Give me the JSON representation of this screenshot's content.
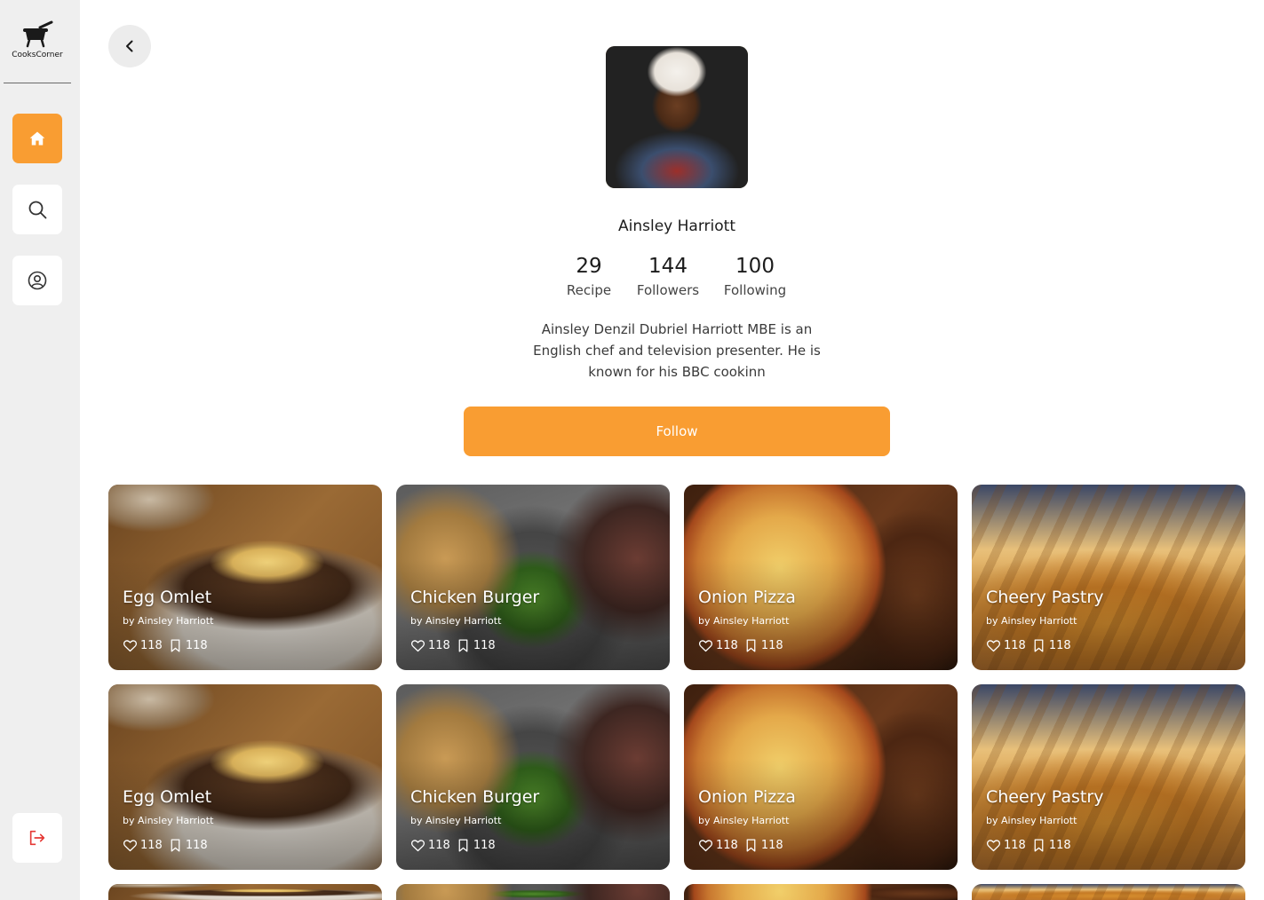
{
  "app": {
    "name": "CooksCorner"
  },
  "colors": {
    "accent": "#F99D32",
    "sidebar_bg": "#EFEFEF",
    "logout_icon": "#E53935"
  },
  "sidebar": {
    "items": [
      {
        "icon": "home-icon",
        "active": true
      },
      {
        "icon": "search-icon",
        "active": false
      },
      {
        "icon": "user-circle-icon",
        "active": false
      }
    ],
    "logout_icon": "logout-icon"
  },
  "profile": {
    "name": "Ainsley Harriott",
    "stats": [
      {
        "value": "29",
        "label": "Recipe"
      },
      {
        "value": "144",
        "label": "Followers"
      },
      {
        "value": "100",
        "label": "Following"
      }
    ],
    "bio": "Ainsley Denzil Dubriel Harriott MBE is an English chef and television presenter. He is known for his BBC cookinn",
    "follow_label": "Follow"
  },
  "recipes": [
    {
      "title": "Egg Omlet",
      "author": "by Ainsley Harriott",
      "likes": "118",
      "saves": "118"
    },
    {
      "title": "Chicken Burger",
      "author": "by Ainsley Harriott",
      "likes": "118",
      "saves": "118"
    },
    {
      "title": "Onion Pizza",
      "author": "by Ainsley Harriott",
      "likes": "118",
      "saves": "118"
    },
    {
      "title": "Cheery Pastry",
      "author": "by Ainsley Harriott",
      "likes": "118",
      "saves": "118"
    },
    {
      "title": "Egg Omlet",
      "author": "by Ainsley Harriott",
      "likes": "118",
      "saves": "118"
    },
    {
      "title": "Chicken Burger",
      "author": "by Ainsley Harriott",
      "likes": "118",
      "saves": "118"
    },
    {
      "title": "Onion Pizza",
      "author": "by Ainsley Harriott",
      "likes": "118",
      "saves": "118"
    },
    {
      "title": "Cheery Pastry",
      "author": "by Ainsley Harriott",
      "likes": "118",
      "saves": "118"
    }
  ]
}
